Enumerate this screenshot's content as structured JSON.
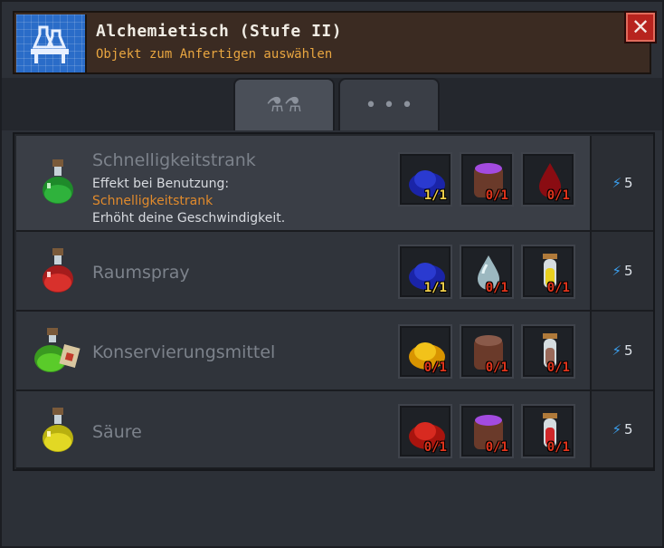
{
  "header": {
    "title": "Alchemietisch (Stufe II)",
    "subtitle": "Objekt zum Anfertigen auswählen",
    "icon": "alchemy-table-icon",
    "close_icon": "close-icon",
    "close_label": "✕"
  },
  "tabs": [
    {
      "icon": "anvil-tools-icon",
      "label": "⚗⚗"
    },
    {
      "icon": "more-dots-icon",
      "label": "• • •"
    }
  ],
  "recipes": [
    {
      "name": "Schnelligkeitstrank",
      "icon": "green-potion-icon",
      "cost": "5",
      "description": {
        "line1": "Effekt bei Benutzung:",
        "effect": "Schnelligkeitstrank",
        "line3": "Erhöht deine Geschwindigkeit."
      },
      "ingredients": [
        {
          "icon": "blue-powder-icon",
          "qty": "1/1"
        },
        {
          "icon": "purple-liquid-pot-icon",
          "qty": "0/1"
        },
        {
          "icon": "red-drop-icon",
          "qty": "0/1"
        }
      ]
    },
    {
      "name": "Raumspray",
      "icon": "red-potion-icon",
      "cost": "5",
      "ingredients": [
        {
          "icon": "blue-powder-icon",
          "qty": "1/1"
        },
        {
          "icon": "water-drop-icon",
          "qty": "0/1"
        },
        {
          "icon": "yellow-vial-icon",
          "qty": "0/1"
        }
      ]
    },
    {
      "name": "Konservierungsmittel",
      "icon": "green-jars-icon",
      "cost": "5",
      "ingredients": [
        {
          "icon": "yellow-powder-icon",
          "qty": "0/1"
        },
        {
          "icon": "brown-liquid-pot-icon",
          "qty": "0/1"
        },
        {
          "icon": "brown-vial-icon",
          "qty": "0/1"
        }
      ]
    },
    {
      "name": "Säure",
      "icon": "yellow-potion-icon",
      "cost": "5",
      "ingredients": [
        {
          "icon": "red-powder-icon",
          "qty": "0/1"
        },
        {
          "icon": "purple-liquid-pot-icon",
          "qty": "0/1"
        },
        {
          "icon": "red-vial-icon",
          "qty": "0/1"
        }
      ]
    }
  ],
  "colors": {
    "accent_orange": "#e9a640",
    "have_qty": "#f1d04a",
    "missing_qty": "#e0341c",
    "energy_blue": "#3aa0f0"
  }
}
